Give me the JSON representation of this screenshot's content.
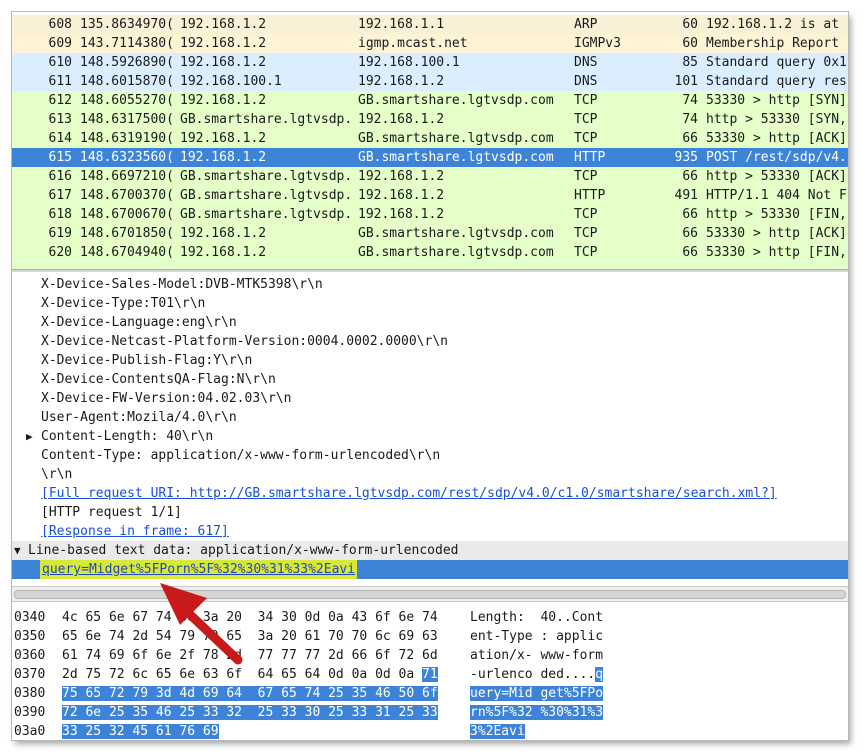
{
  "packets": [
    {
      "no": "608",
      "time": "135.8634970(",
      "src": "192.168.1.2",
      "dst": "192.168.1.1",
      "proto": "ARP",
      "len": "60",
      "info": "192.168.1.2 is at",
      "cls": "bg-arp"
    },
    {
      "no": "609",
      "time": "143.7114380(",
      "src": "192.168.1.2",
      "dst": "igmp.mcast.net",
      "proto": "IGMPv3",
      "len": "60",
      "info": "Membership Report",
      "cls": "bg-igmp"
    },
    {
      "no": "610",
      "time": "148.5926890(",
      "src": "192.168.1.2",
      "dst": "192.168.100.1",
      "proto": "DNS",
      "len": "85",
      "info": "Standard query 0x1",
      "cls": "bg-dns"
    },
    {
      "no": "611",
      "time": "148.6015870(",
      "src": "192.168.100.1",
      "dst": "192.168.1.2",
      "proto": "DNS",
      "len": "101",
      "info": "Standard query res",
      "cls": "bg-dns"
    },
    {
      "no": "612",
      "time": "148.6055270(",
      "src": "192.168.1.2",
      "dst": "GB.smartshare.lgtvsdp.com",
      "proto": "TCP",
      "len": "74",
      "info": "53330 > http [SYN]",
      "cls": "bg-tcp"
    },
    {
      "no": "613",
      "time": "148.6317500(",
      "src": "GB.smartshare.lgtvsdp.",
      "dst": "192.168.1.2",
      "proto": "TCP",
      "len": "74",
      "info": "http > 53330 [SYN,",
      "cls": "bg-tcp"
    },
    {
      "no": "614",
      "time": "148.6319190(",
      "src": "192.168.1.2",
      "dst": "GB.smartshare.lgtvsdp.com",
      "proto": "TCP",
      "len": "66",
      "info": "53330 > http [ACK]",
      "cls": "bg-tcp"
    },
    {
      "no": "615",
      "time": "148.6323560(",
      "src": "192.168.1.2",
      "dst": "GB.smartshare.lgtvsdp.com",
      "proto": "HTTP",
      "len": "935",
      "info": "POST /rest/sdp/v4.",
      "cls": "bg-sel"
    },
    {
      "no": "616",
      "time": "148.6697210(",
      "src": "GB.smartshare.lgtvsdp.",
      "dst": "192.168.1.2",
      "proto": "TCP",
      "len": "66",
      "info": "http > 53330 [ACK]",
      "cls": "bg-tcp"
    },
    {
      "no": "617",
      "time": "148.6700370(",
      "src": "GB.smartshare.lgtvsdp.",
      "dst": "192.168.1.2",
      "proto": "HTTP",
      "len": "491",
      "info": "HTTP/1.1 404 Not F",
      "cls": "bg-tcp"
    },
    {
      "no": "618",
      "time": "148.6700670(",
      "src": "GB.smartshare.lgtvsdp.",
      "dst": "192.168.1.2",
      "proto": "TCP",
      "len": "66",
      "info": "http > 53330 [FIN,",
      "cls": "bg-tcp"
    },
    {
      "no": "619",
      "time": "148.6701850(",
      "src": "192.168.1.2",
      "dst": "GB.smartshare.lgtvsdp.com",
      "proto": "TCP",
      "len": "66",
      "info": "53330 > http [ACK]",
      "cls": "bg-tcp"
    },
    {
      "no": "620",
      "time": "148.6704940(",
      "src": "192.168.1.2",
      "dst": "GB.smartshare.lgtvsdp.com",
      "proto": "TCP",
      "len": "66",
      "info": "53330 > http [FIN,",
      "cls": "bg-tcp"
    }
  ],
  "details": {
    "l0": "X-Device-Sales-Model:DVB-MTK5398\\r\\n",
    "l1": "X-Device-Type:T01\\r\\n",
    "l2": "X-Device-Language:eng\\r\\n",
    "l3": "X-Device-Netcast-Platform-Version:0004.0002.0000\\r\\n",
    "l4": "X-Device-Publish-Flag:Y\\r\\n",
    "l5": "X-Device-ContentsQA-Flag:N\\r\\n",
    "l6": "X-Device-FW-Version:04.02.03\\r\\n",
    "l7": "User-Agent:Mozila/4.0\\r\\n",
    "l8": "Content-Length: 40\\r\\n",
    "l9": "Content-Type: application/x-www-form-urlencoded\\r\\n",
    "l10": "\\r\\n",
    "l11": "[Full request URI: http://GB.smartshare.lgtvsdp.com/rest/sdp/v4.0/c1.0/smartshare/search.xml?]",
    "l12": "[HTTP request 1/1]",
    "l13": "[Response in frame: 617]",
    "section": "Line-based text data: application/x-www-form-urlencoded",
    "query": "query=Midget%5FPorn%5F%32%30%31%33%2Eavi"
  },
  "hex": [
    {
      "off": "0340",
      "pre": "4c 65 6e 67 74 68 3a 20  34 30 0d 0a 43 6f 6e 74",
      "sel": "",
      "apre": "Length:  40..Cont",
      "asel": ""
    },
    {
      "off": "0350",
      "pre": "65 6e 74 2d 54 79 70 65  3a 20 61 70 70 6c 69 63",
      "sel": "",
      "apre": "ent-Type : applic",
      "asel": ""
    },
    {
      "off": "0360",
      "pre": "61 74 69 6f 6e 2f 78 2d  77 77 77 2d 66 6f 72 6d",
      "sel": "",
      "apre": "ation/x- www-form",
      "asel": ""
    },
    {
      "off": "0370",
      "pre": "2d 75 72 6c 65 6e 63 6f  64 65 64 0d 0a 0d 0a ",
      "sel": "71",
      "apre": "-urlenco ded....",
      "asel": "q"
    },
    {
      "off": "0380",
      "pre": "",
      "sel": "75 65 72 79 3d 4d 69 64  67 65 74 25 35 46 50 6f",
      "apre": "",
      "asel": "uery=Mid get%5FPo"
    },
    {
      "off": "0390",
      "pre": "",
      "sel": "72 6e 25 35 46 25 33 32  25 33 30 25 33 31 25 33",
      "apre": "",
      "asel": "rn%5F%32 %30%31%3"
    },
    {
      "off": "03a0",
      "pre": "",
      "sel": "33 25 32 45 61 76 69",
      "apre": "",
      "asel": "3%2Eavi"
    }
  ]
}
